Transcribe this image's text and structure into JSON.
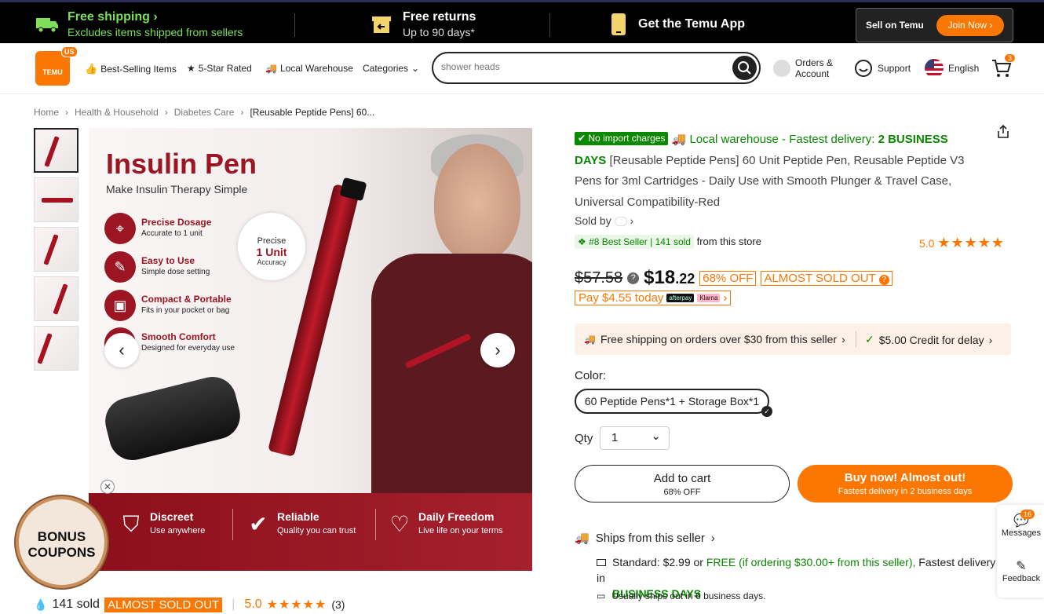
{
  "topbar": {
    "free_shipping_title": "Free shipping",
    "free_shipping_sub": "Excludes items shipped from sellers",
    "free_returns_title": "Free returns",
    "free_returns_sub": "Up to 90 days*",
    "get_app": "Get the Temu App",
    "sell_label": "Sell on Temu",
    "join_label": "Join Now"
  },
  "header": {
    "logo_text": "TEMU",
    "logo_region": "US",
    "nav": [
      "Best-Selling Items",
      "5-Star Rated",
      "Local Warehouse",
      "Categories"
    ],
    "search_placeholder": "shower heads",
    "orders_line1": "Orders &",
    "orders_line2": "Account",
    "support": "Support",
    "language": "English",
    "cart_count": "3"
  },
  "breadcrumb": [
    "Home",
    "Health & Household",
    "Diabetes Care",
    "[Reusable Peptide Pens] 60..."
  ],
  "gallery": {
    "image_title": "Insulin Pen",
    "image_subtitle": "Make Insulin Therapy Simple",
    "features": [
      {
        "title": "Precise Dosage",
        "desc": "Accurate to 1 unit"
      },
      {
        "title": "Easy to Use",
        "desc": "Simple dose setting"
      },
      {
        "title": "Compact & Portable",
        "desc": "Fits in your pocket or bag"
      },
      {
        "title": "Smooth Comfort",
        "desc": "Designed for everyday use"
      }
    ],
    "precise_a": "Precise",
    "precise_b": "1 Unit",
    "precise_c": "Accuracy",
    "footer": [
      {
        "title": "Discreet",
        "desc": "Use anywhere"
      },
      {
        "title": "Reliable",
        "desc": "Quality you can trust"
      },
      {
        "title": "Daily Freedom",
        "desc": "Live life on your terms"
      }
    ]
  },
  "bonus": {
    "line1": "BONUS",
    "line2": "COUPONS"
  },
  "bottom_stats": {
    "sold": "141 sold",
    "tag": "ALMOST SOLD OUT",
    "rating": "5.0",
    "reviews": "(3)"
  },
  "product": {
    "no_import": "No import charges",
    "local_wh": "Local warehouse - Fastest delivery:",
    "days": "2 BUSINESS DAYS",
    "title": "[Reusable Peptide Pens] 60 Unit Peptide Pen, Reusable Peptide V3 Pens for 3ml Cartridges - Daily Use with Smooth Plunger & Travel Case, Universal Compatibility-Red",
    "sold_by": "Sold by",
    "best_seller": "#8 Best Seller | 141 sold",
    "from_store": "from this store",
    "store_rating": "5.0",
    "old_price": "$57.58",
    "new_price_dollars": "$18",
    "new_price_cents": ".22",
    "discount": "68% OFF",
    "almost": "ALMOST SOLD OUT",
    "pay_today": "Pay $4.55 today",
    "afterpay": "afterpay",
    "klarna": "Klarna",
    "free_ship_seller": "Free shipping on orders over $30 from this seller",
    "credit": "$5.00 Credit for delay",
    "color_label": "Color:",
    "color_option": "60 Peptide Pens*1 + Storage Box*1",
    "qty_label": "Qty",
    "qty_value": "1",
    "add_to_cart": "Add to cart",
    "add_to_cart_sub": "68% OFF",
    "buy_now": "Buy now! Almost out!",
    "buy_now_sub": "Fastest delivery in 2 business days",
    "ships_from": "Ships from this seller",
    "standard": "Standard: $2.99 or",
    "free_if": "FREE (if ordering $30.00+ from this seller),",
    "fastest": "Fastest delivery in",
    "business_days": "BUSINESS DAYS",
    "usually": "Usually ships out in 6 business days."
  },
  "side": {
    "messages": "Messages",
    "messages_count": "16",
    "feedback": "Feedback"
  },
  "colors": {
    "accent": "#fb7701",
    "green": "#0a8800",
    "brand_red": "#9b1523"
  }
}
